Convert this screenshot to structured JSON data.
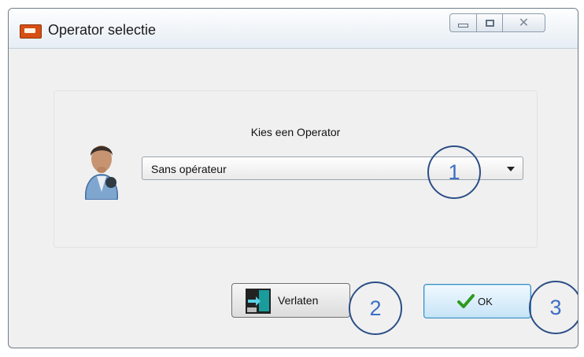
{
  "window": {
    "title": "Operator selectie",
    "controls": {
      "minimize": "minimize",
      "maximize": "maximize",
      "close": "✕"
    }
  },
  "dialog": {
    "prompt": "Kies een Operator",
    "operator_select": {
      "value": "Sans opérateur"
    },
    "buttons": {
      "exit_label": "Verlaten",
      "ok_label": "OK"
    }
  },
  "annotations": {
    "callout_1": "1",
    "callout_2": "2",
    "callout_3": "3"
  },
  "colors": {
    "accent": "#3c8fc3",
    "callout_ring": "#2c4e86",
    "callout_text": "#3c6fc4"
  },
  "icons": [
    "app-icon",
    "user-avatar-icon",
    "exit-door-icon",
    "checkmark-icon",
    "chevron-down-icon"
  ]
}
